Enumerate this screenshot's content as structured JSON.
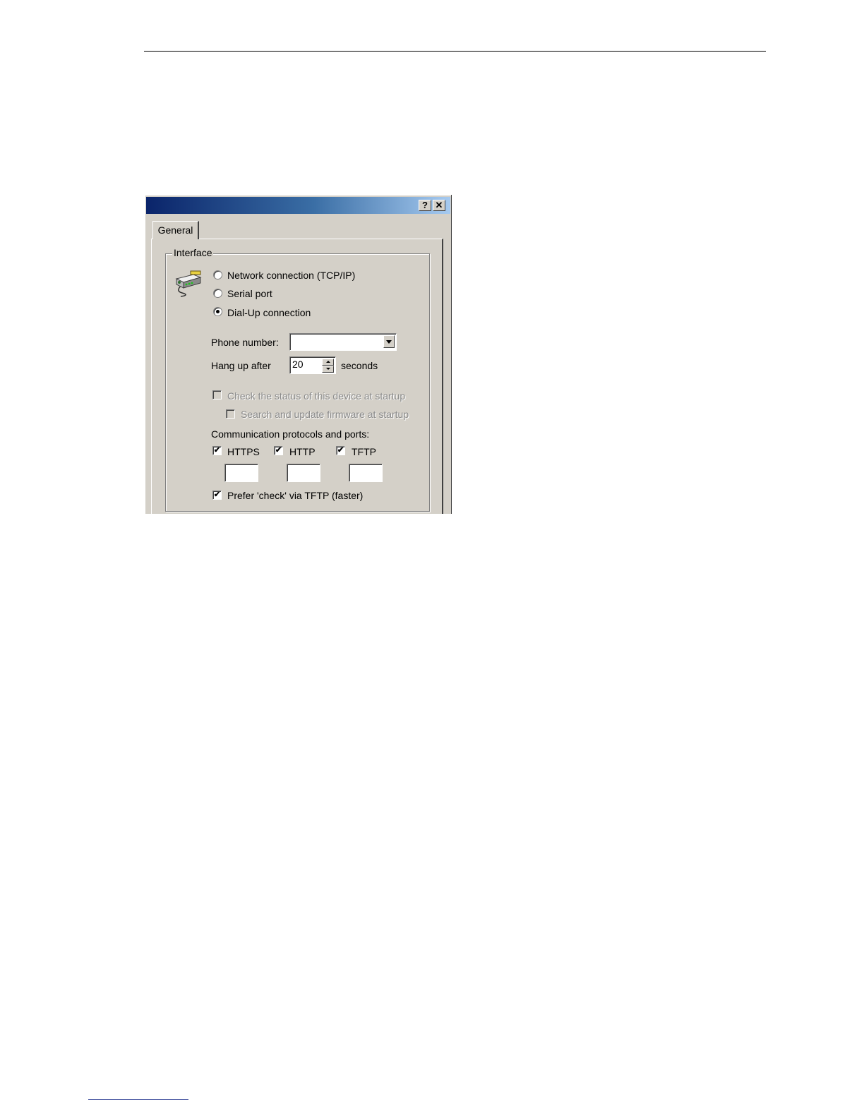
{
  "dialog": {
    "title_buttons": {
      "help": "?",
      "close": "✕"
    },
    "tabs": [
      {
        "label": "General"
      }
    ],
    "interface_group": {
      "label": "Interface",
      "icon": "modem-cable-icon",
      "options": [
        {
          "label": "Network connection (TCP/IP)",
          "selected": false
        },
        {
          "label": "Serial port",
          "selected": false
        },
        {
          "label": "Dial-Up connection",
          "selected": true
        }
      ],
      "phone_number": {
        "label": "Phone number:",
        "value": ""
      },
      "hang_up": {
        "label": "Hang up after",
        "value": "20",
        "unit": "seconds"
      },
      "check_status": {
        "label": "Check the status of this device at startup",
        "checked": false,
        "enabled": false
      },
      "search_firmware": {
        "label": "Search and update firmware at startup",
        "checked": false,
        "enabled": false
      },
      "protocols": {
        "label": "Communication protocols and ports:",
        "items": [
          {
            "label": "HTTPS",
            "checked": true,
            "port": ""
          },
          {
            "label": "HTTP",
            "checked": true,
            "port": ""
          },
          {
            "label": "TFTP",
            "checked": true,
            "port": ""
          }
        ]
      },
      "prefer_tftp": {
        "label": "Prefer 'check' via TFTP (faster)",
        "checked": true
      }
    }
  }
}
